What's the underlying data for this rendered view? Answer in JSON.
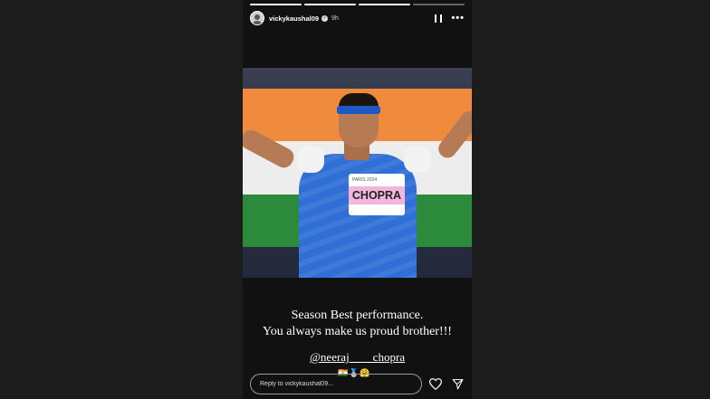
{
  "story": {
    "progress": [
      true,
      true,
      true,
      false
    ],
    "username": "vickykaushal09",
    "time": "9h",
    "more_label": "•••",
    "photo": {
      "bib_name": "CHOPRA",
      "bib_event": "PARIS 2024"
    },
    "caption": {
      "line1": "Season Best performance.",
      "line2": "You always make us proud brother!!!"
    },
    "mention": "@neeraj____chopra",
    "emojis": "🇮🇳🥈🤗",
    "reply": {
      "placeholder": "Reply to vickykaushal09..."
    }
  },
  "icons": [
    "profile-avatar",
    "verified-icon",
    "pause-icon",
    "more-options-icon",
    "heart-icon",
    "send-icon"
  ],
  "colors": {
    "background": "#1c1c1c",
    "story_background": "#111111",
    "jersey": "#2f6fd6",
    "bib_stripe": "#f2b6dd",
    "flag_saffron": "#f08a3c",
    "flag_green": "#2c8a3c"
  }
}
